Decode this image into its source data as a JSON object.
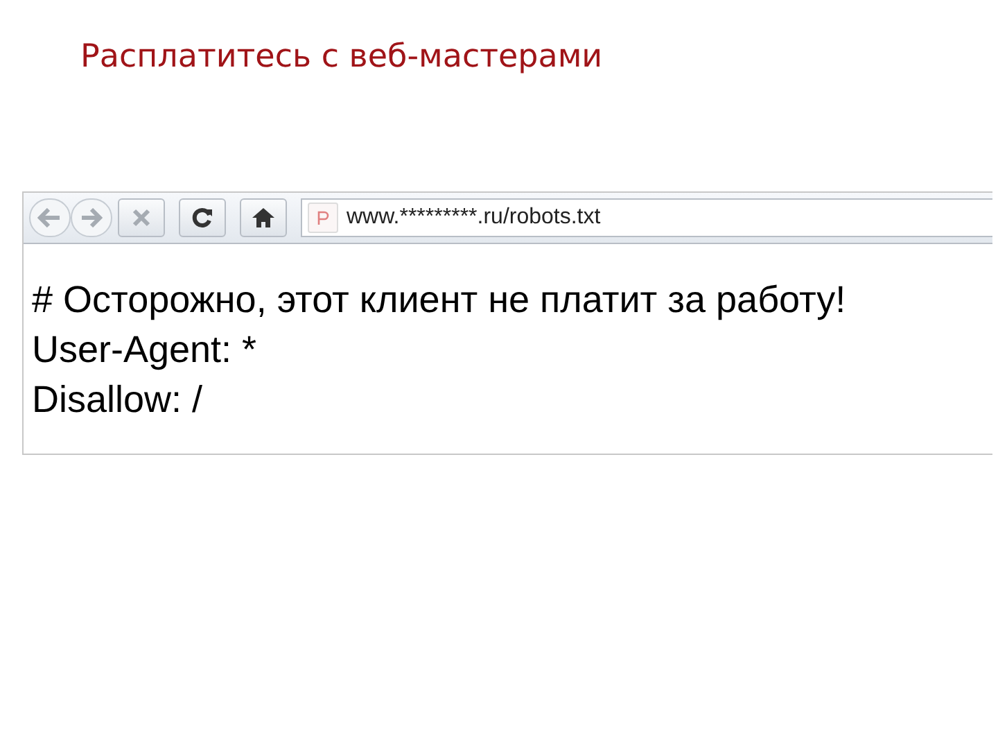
{
  "slide_title": "Расплатитесь с веб-мастерами",
  "browser": {
    "toolbar": [
      {
        "kind": "back",
        "disabled": true
      },
      {
        "kind": "forward",
        "disabled": true
      },
      {
        "kind": "stop",
        "disabled": true
      },
      {
        "kind": "reload",
        "disabled": false
      },
      {
        "kind": "home",
        "disabled": false
      }
    ],
    "address": "www.*********.ru/robots.txt",
    "lines": [
      "# Осторожно, этот клиент не платит за работу!",
      "User-Agent: *",
      "Disallow: /"
    ]
  }
}
